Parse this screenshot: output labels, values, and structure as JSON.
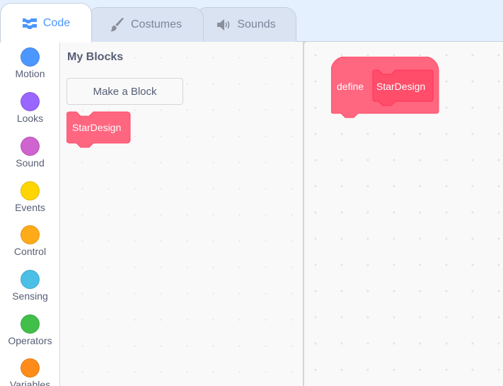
{
  "tabs": [
    {
      "label": "Code",
      "icon": "code-blocks-icon",
      "active": true
    },
    {
      "label": "Costumes",
      "icon": "paintbrush-icon",
      "active": false
    },
    {
      "label": "Sounds",
      "icon": "speaker-icon",
      "active": false
    }
  ],
  "categories": [
    {
      "label": "Motion",
      "color": "#4c97ff"
    },
    {
      "label": "Looks",
      "color": "#9966ff"
    },
    {
      "label": "Sound",
      "color": "#cf63cf"
    },
    {
      "label": "Events",
      "color": "#ffd500"
    },
    {
      "label": "Control",
      "color": "#ffab19"
    },
    {
      "label": "Sensing",
      "color": "#4cbfe6"
    },
    {
      "label": "Operators",
      "color": "#40bf4a"
    },
    {
      "label": "Variables",
      "color": "#ff8c1a"
    }
  ],
  "flyout": {
    "title": "My Blocks",
    "make_block_label": "Make a Block",
    "blocks": [
      {
        "label": "StarDesign"
      }
    ]
  },
  "workspace": {
    "define_block": {
      "keyword": "define",
      "name": "StarDesign"
    }
  },
  "colors": {
    "my_blocks": "#ff6680",
    "my_blocks_dark": "#ff4d6a",
    "my_blocks_border": "#ff3355",
    "accent": "#4c97ff"
  }
}
